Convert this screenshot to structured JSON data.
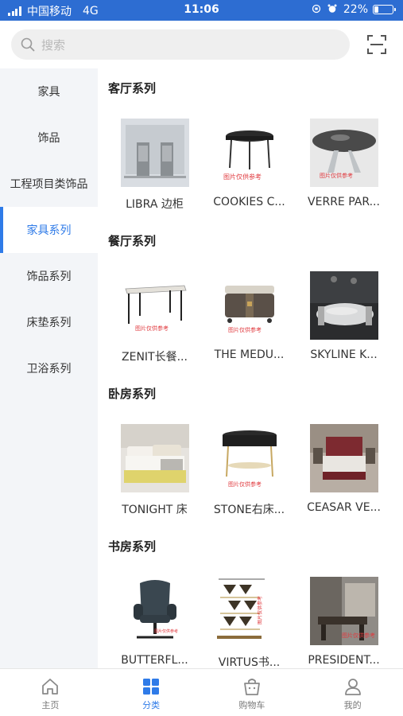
{
  "status": {
    "carrier": "中国移动",
    "network": "4G",
    "time": "11:06",
    "battery": "22%",
    "battery_level": 0.22
  },
  "search": {
    "placeholder": "搜索"
  },
  "sidebar": {
    "items": [
      {
        "label": "家具",
        "active": false
      },
      {
        "label": "饰品",
        "active": false
      },
      {
        "label": "工程项目类饰品",
        "active": false
      },
      {
        "label": "家具系列",
        "active": true
      },
      {
        "label": "饰品系列",
        "active": false
      },
      {
        "label": "床垫系列",
        "active": false
      },
      {
        "label": "卫浴系列",
        "active": false
      }
    ]
  },
  "sections": [
    {
      "title": "客厅系列",
      "items": [
        {
          "name": "LIBRA 边柜",
          "image": "cabinet-image"
        },
        {
          "name": "COOKIES C...",
          "image": "side-table-image"
        },
        {
          "name": "VERRE PAR...",
          "image": "round-table-image"
        }
      ]
    },
    {
      "title": "餐厅系列",
      "items": [
        {
          "name": "ZENIT长餐...",
          "image": "dining-table-image"
        },
        {
          "name": "THE MEDU...",
          "image": "sideboard-image"
        },
        {
          "name": "SKYLINE K...",
          "image": "dining-room-image"
        }
      ]
    },
    {
      "title": "卧房系列",
      "items": [
        {
          "name": "TONIGHT 床",
          "image": "bed-image"
        },
        {
          "name": "STONE右床...",
          "image": "nightstand-image"
        },
        {
          "name": "CEASAR VE...",
          "image": "bedroom-image"
        }
      ]
    },
    {
      "title": "书房系列",
      "items": [
        {
          "name": "BUTTERFL...",
          "image": "office-chair-image"
        },
        {
          "name": "VIRTUS书...",
          "image": "bookshelf-image"
        },
        {
          "name": "PRESIDENT...",
          "image": "study-room-image"
        }
      ]
    }
  ],
  "watermark": "图片仅供参考",
  "tabs": [
    {
      "label": "主页",
      "icon": "home-icon",
      "active": false
    },
    {
      "label": "分类",
      "icon": "category-icon",
      "active": true
    },
    {
      "label": "购物车",
      "icon": "cart-icon",
      "active": false
    },
    {
      "label": "我的",
      "icon": "profile-icon",
      "active": false
    }
  ],
  "colors": {
    "accent": "#2f7be8",
    "statusbar": "#2d6dd2",
    "sidebar_bg": "#f3f5f8"
  }
}
